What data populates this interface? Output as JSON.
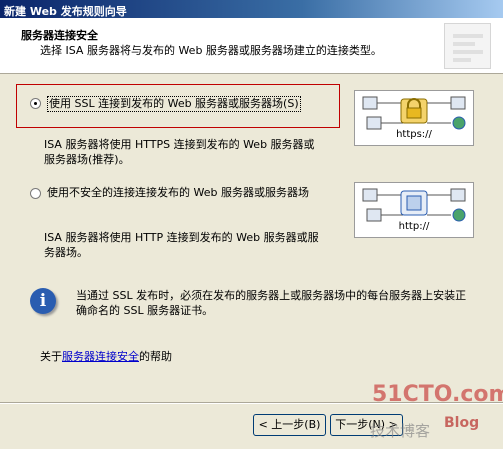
{
  "window": {
    "title": "新建 Web 发布规则向导"
  },
  "header": {
    "title": "服务器连接安全",
    "subtitle": "选择 ISA 服务器将与发布的 Web 服务器或服务器场建立的连接类型。"
  },
  "options": [
    {
      "label": "使用 SSL 连接到发布的 Web 服务器或服务器场(S)",
      "description": "ISA 服务器将使用 HTTPS 连接到发布的 Web 服务器或服务器场(推荐)。",
      "checked": true,
      "diagram_caption": "https://"
    },
    {
      "label": "使用不安全的连接连接发布的 Web 服务器或服务器场",
      "description": "ISA 服务器将使用 HTTP 连接到发布的 Web 服务器或服务器场。",
      "checked": false,
      "diagram_caption": "http://"
    }
  ],
  "info": {
    "icon": "info-icon",
    "text": "当通过 SSL 发布时，必须在发布的服务器上或服务器场中的每台服务器上安装正确命名的 SSL 服务器证书。"
  },
  "help": {
    "prefix": "关于",
    "link": "服务器连接安全",
    "suffix": "的帮助"
  },
  "buttons": {
    "back": "< 上一步(B)",
    "next": "下一步(N) >"
  },
  "watermark": {
    "site": "51CTO.com",
    "tagline": "技术博客",
    "blog": "Blog"
  }
}
